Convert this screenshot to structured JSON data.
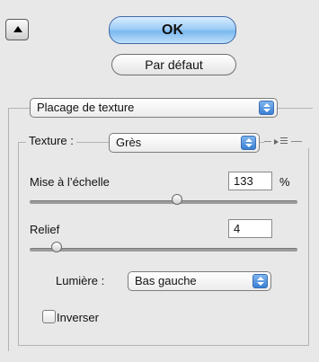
{
  "buttons": {
    "ok_label": "OK",
    "default_label": "Par défaut"
  },
  "mapping": {
    "selected": "Placage de texture"
  },
  "texture": {
    "label": "Texture :",
    "selected": "Grès"
  },
  "scale": {
    "label": "Mise à l’échelle",
    "value": "133",
    "unit": "%",
    "slider_fraction": 0.55
  },
  "relief": {
    "label": "Relief",
    "value": "4",
    "slider_fraction": 0.1
  },
  "light": {
    "label": "Lumière :",
    "selected": "Bas gauche"
  },
  "invert": {
    "label": "Inverser",
    "checked": false
  },
  "icons": {
    "collapse": "triangle-up-icon",
    "popup_arrows": "up-down-arrows-icon",
    "panel_menu": "panel-menu-icon"
  },
  "colors": {
    "default_button_blue": "#7bb8ef",
    "popup_arrow_blue": "#3a7fd4"
  }
}
